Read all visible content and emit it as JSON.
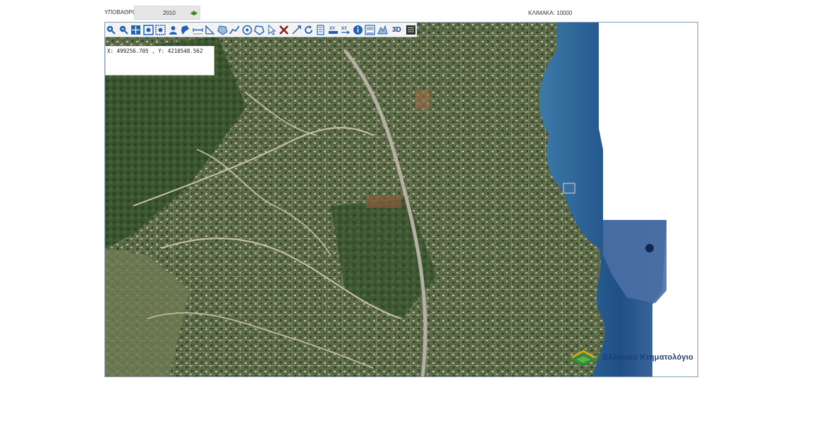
{
  "header": {
    "basemap_label": "ΥΠΟΒΑΘΡΟ:",
    "basemap_value": "2010",
    "scale_text": "ΚΛΙΜΑΚΑ: 10000"
  },
  "toolbar": {
    "tools": [
      {
        "name": "zoom-in-icon"
      },
      {
        "name": "zoom-out-icon"
      },
      {
        "name": "pan-icon"
      },
      {
        "name": "full-extent-icon"
      },
      {
        "name": "zoom-box-icon"
      },
      {
        "name": "user-info-icon"
      },
      {
        "name": "locate-icon"
      },
      {
        "name": "measure-distance-icon"
      },
      {
        "name": "measure-angle-icon"
      },
      {
        "name": "measure-area-icon"
      },
      {
        "name": "draw-line-icon"
      },
      {
        "name": "circle-target-icon"
      },
      {
        "name": "polygon-select-icon"
      },
      {
        "name": "select-arrow-icon"
      },
      {
        "name": "clear-icon"
      },
      {
        "name": "zoom-to-point-icon"
      },
      {
        "name": "refresh-icon"
      },
      {
        "name": "print-icon"
      },
      {
        "name": "xy-coordinates-icon"
      },
      {
        "name": "xy-transform-icon"
      },
      {
        "name": "info-icon"
      },
      {
        "name": "map-layer-icon"
      },
      {
        "name": "profile-icon"
      },
      {
        "name": "three-d-button",
        "label": "3D"
      },
      {
        "name": "legend-icon"
      }
    ]
  },
  "coordinates": {
    "text": "X: 499256.705 , Y: 4210548.562"
  },
  "brand": {
    "text": "Ελληνικό Κτηματολόγιο"
  },
  "colors": {
    "toolbar_icon": "#1f5fb8",
    "land_dark": "#3d5a32",
    "land_light": "#7d8a5e",
    "sea": "#1f4f86",
    "brand": "#1c3c78"
  }
}
